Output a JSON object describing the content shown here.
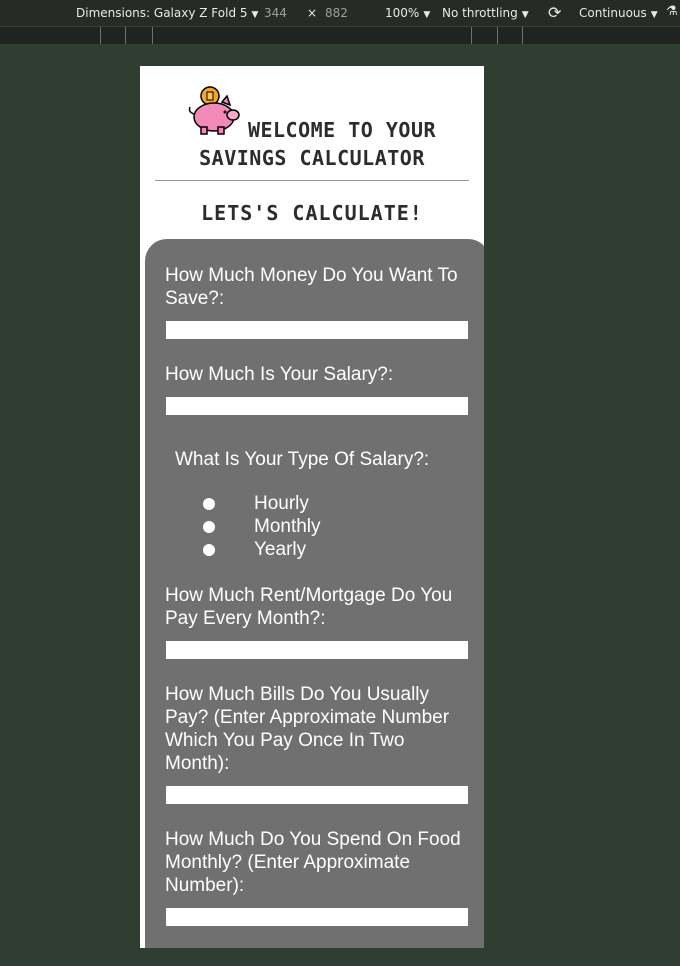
{
  "devtools": {
    "dimensions_label": "Dimensions: Galaxy Z Fold 5",
    "width": "344",
    "times": "×",
    "height": "882",
    "zoom": "100%",
    "throttling": "No throttling",
    "mode": "Continuous"
  },
  "page": {
    "title_line1": "WELCOME TO YOUR",
    "title_line2": "SAVINGS CALCULATOR",
    "subtitle": "LETS'S CALCULATE!",
    "questions": {
      "save_goal": "How Much Money Do You Want To Save?:",
      "salary": "How Much Is Your Salary?:",
      "salary_type": "What Is Your Type Of Salary?:",
      "rent": "How Much Rent/Mortgage Do You Pay Every Month?:",
      "bills": "How Much Bills Do You Usually Pay? (Enter Approximate Number Which You Pay Once In Two Month):",
      "food": "How Much Do You Spend On Food Monthly? (Enter Approximate Number):"
    },
    "salary_options": [
      "Hourly",
      "Monthly",
      "Yearly"
    ],
    "fields": {
      "save_goal": "",
      "salary": "",
      "rent": "",
      "bills": "",
      "food": ""
    }
  },
  "colors": {
    "page_bg": "#2e3f31",
    "form_bg": "#707070",
    "piggy": "#f28ab8",
    "coin": "#f5a623"
  }
}
